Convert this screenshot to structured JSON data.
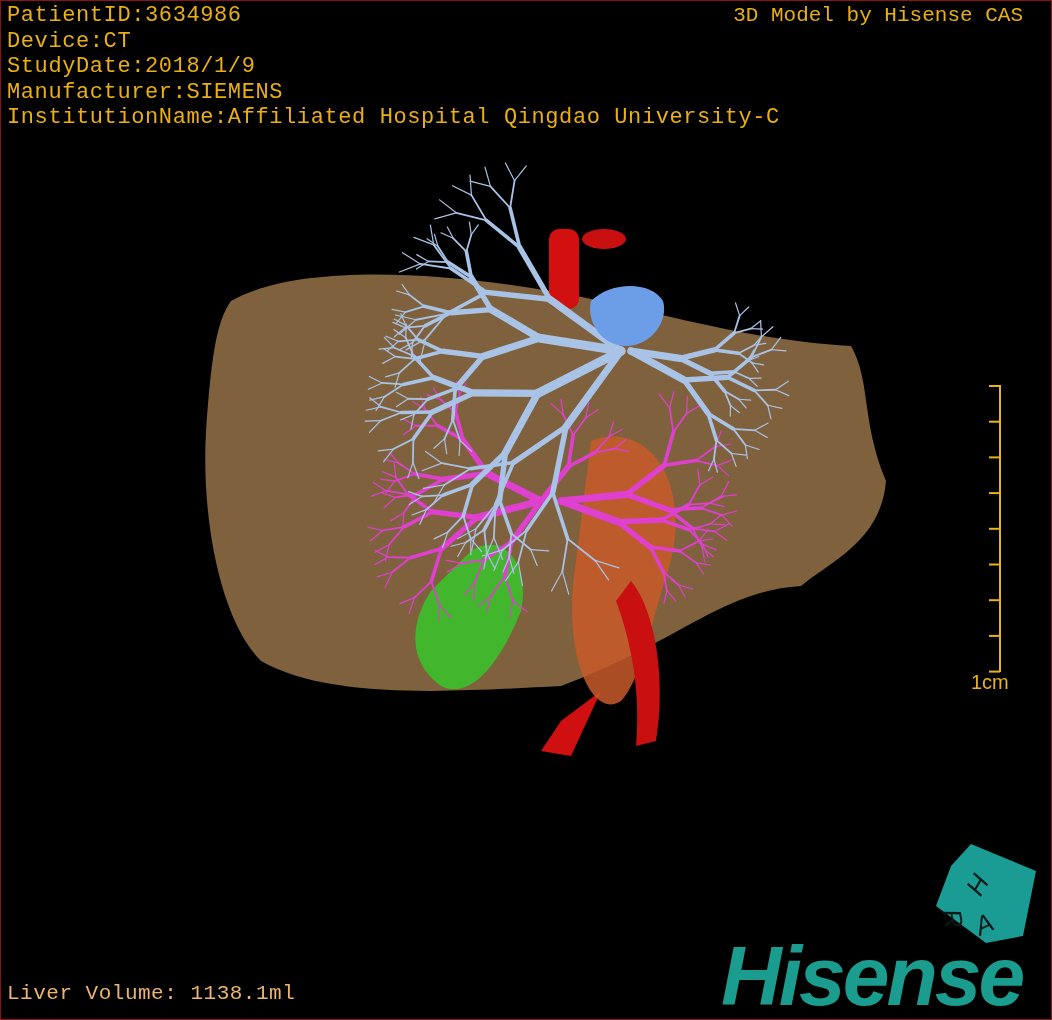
{
  "patient_info": [
    "PatientID:3634986",
    "Device:CT",
    "StudyDate:2018/1/9",
    "Manufacturer:SIEMENS",
    "InstitutionName:Affiliated Hospital Qingdao University-C"
  ],
  "title": "3D Model by Hisense CAS",
  "scale_bar": {
    "label": "1cm"
  },
  "orientation_cube": {
    "faces": [
      "H",
      "R",
      "A"
    ]
  },
  "logo": "Hisense",
  "footer": {
    "liver_volume": "Liver Volume: 1138.1ml"
  }
}
